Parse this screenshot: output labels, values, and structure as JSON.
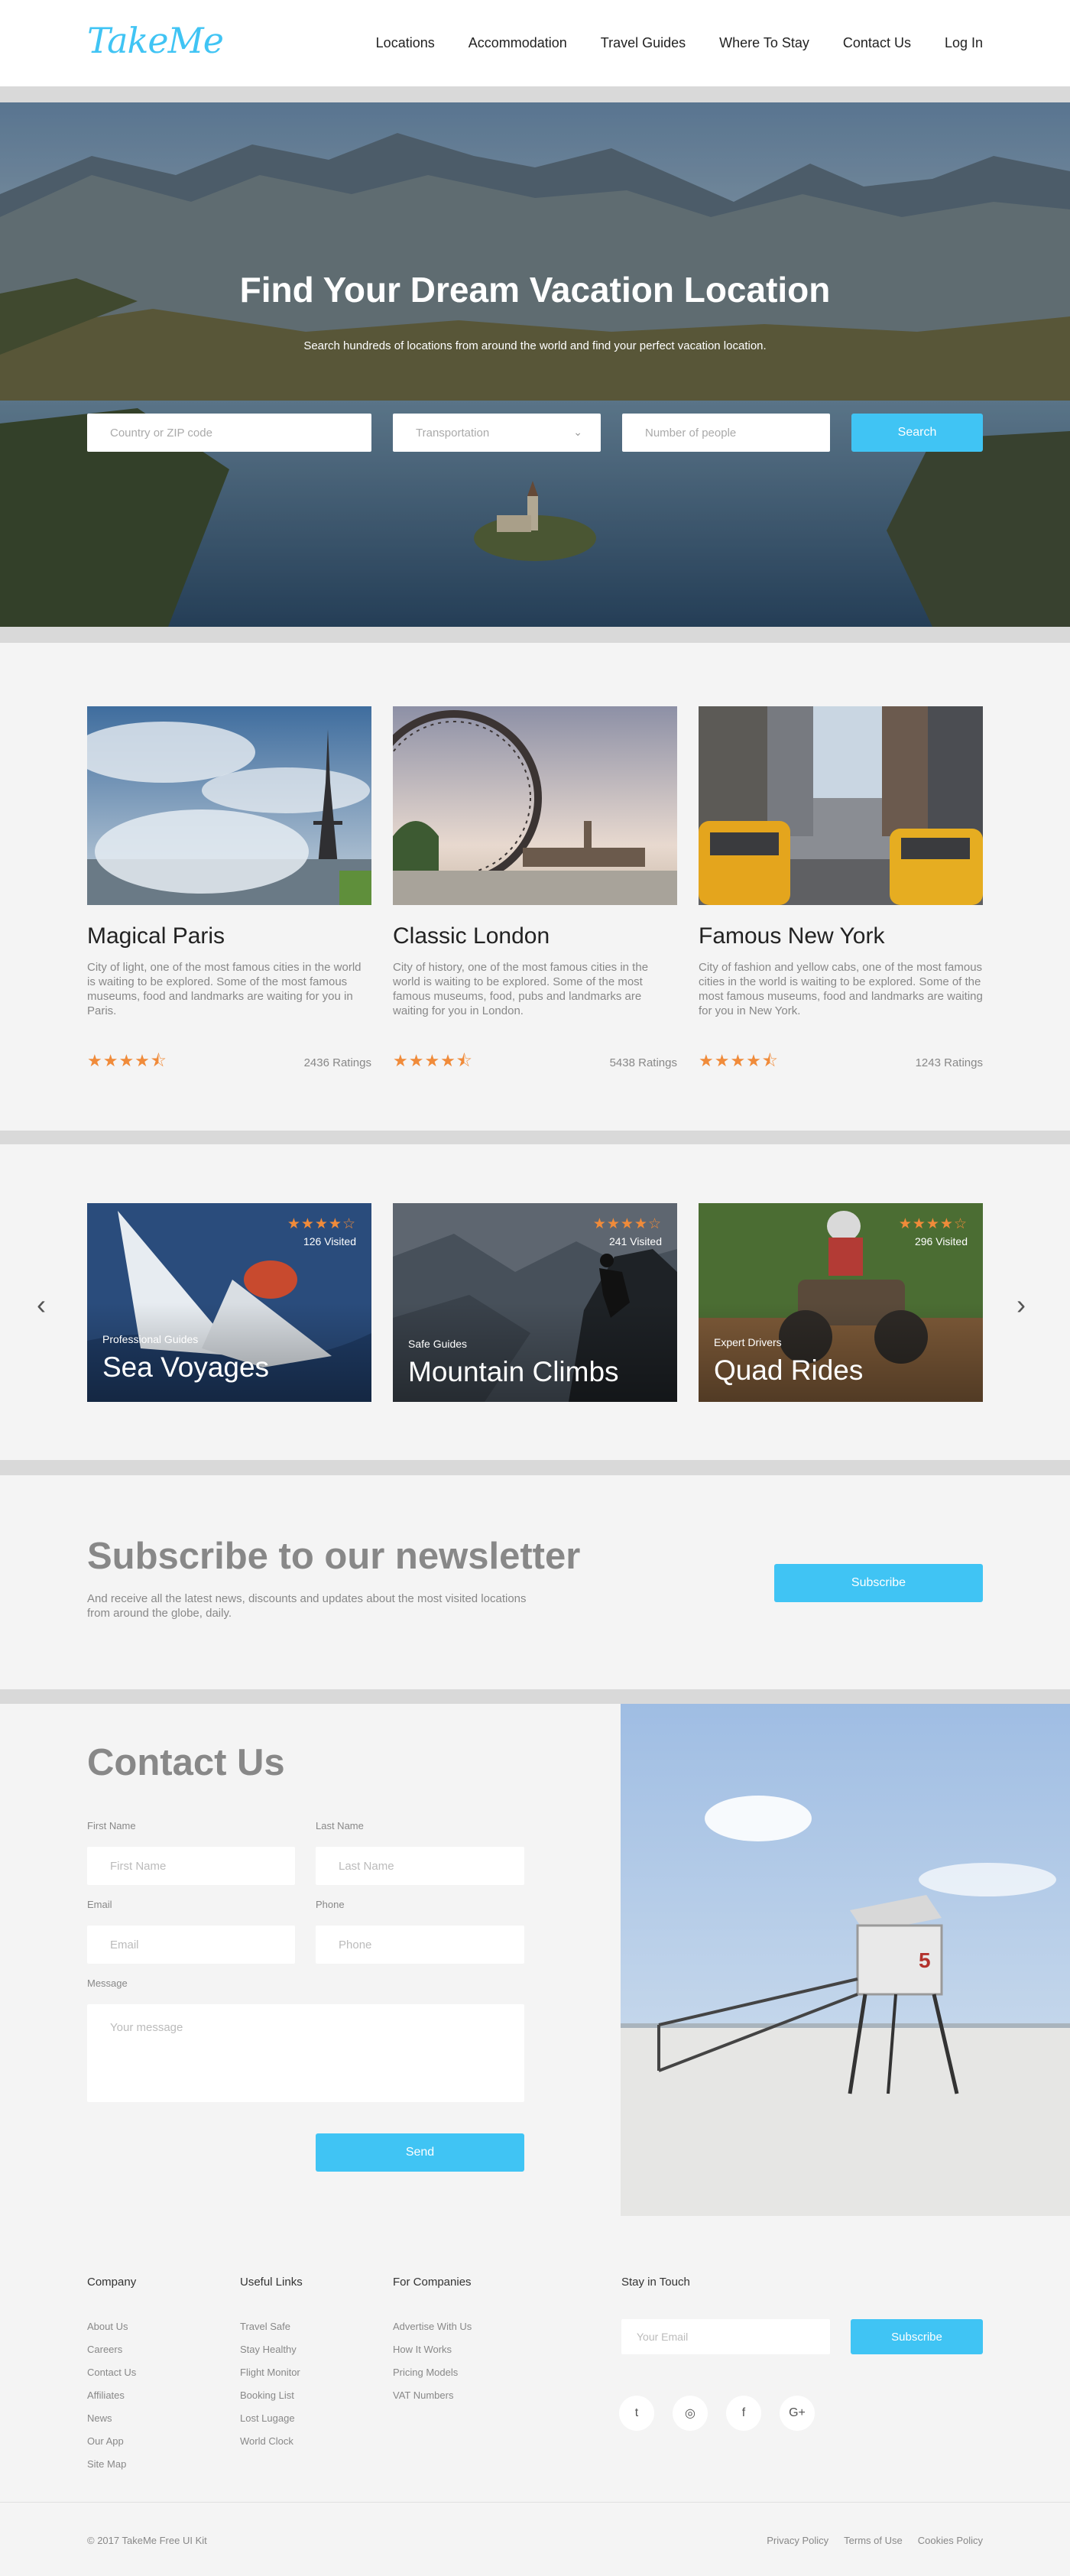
{
  "header": {
    "logo": "TakeMe",
    "nav": [
      "Locations",
      "Accommodation",
      "Travel Guides",
      "Where To Stay",
      "Contact Us",
      "Log In"
    ]
  },
  "hero": {
    "title": "Find Your Dream Vacation Location",
    "subtitle": "Search hundreds of locations from around the world and find your perfect vacation location.",
    "location_placeholder": "Country or ZIP code",
    "transport_placeholder": "Transportation",
    "people_placeholder": "Number of people",
    "search_label": "Search"
  },
  "destinations": [
    {
      "name": "Magical Paris",
      "description": "City of light, one of the most famous cities in the world is waiting to be explored. Some of the most famous museums, food and landmarks are waiting for you in Paris.",
      "stars": "★★★★⯪",
      "rating": 4.5,
      "ratings": "2436 Ratings"
    },
    {
      "name": "Classic London",
      "description": "City of history, one of the most famous cities in the world is waiting to be explored. Some of the most famous museums, food, pubs and landmarks are waiting for you in London.",
      "stars": "★★★★⯪",
      "rating": 4.5,
      "ratings": "5438 Ratings"
    },
    {
      "name": "Famous New York",
      "description": "City of fashion and yellow cabs, one of the most famous cities in the world is waiting to be explored. Some of the most famous museums, food and landmarks are waiting for you in New York.",
      "stars": "★★★★⯪",
      "rating": 4.5,
      "ratings": "1243 Ratings"
    }
  ],
  "activities": [
    {
      "tag": "Professional Guides",
      "name": "Sea Voyages",
      "stars": "★★★★☆",
      "rating": 4,
      "visited": "126 Visited"
    },
    {
      "tag": "Safe Guides",
      "name": "Mountain Climbs",
      "stars": "★★★★☆",
      "rating": 4,
      "visited": "241 Visited"
    },
    {
      "tag": "Expert Drivers",
      "name": "Quad Rides",
      "stars": "★★★★☆",
      "rating": 4,
      "visited": "296 Visited"
    }
  ],
  "carousel": {
    "prev": "‹",
    "next": "›"
  },
  "newsletter": {
    "title": "Subscribe to our newsletter",
    "text": "And receive all the latest news, discounts and updates about the most visited locations from around the globe, daily.",
    "button": "Subscribe"
  },
  "contact": {
    "title": "Contact Us",
    "first_name_label": "First Name",
    "first_name_placeholder": "First Name",
    "last_name_label": "Last Name",
    "last_name_placeholder": "Last Name",
    "email_label": "Email",
    "email_placeholder": "Email",
    "phone_label": "Phone",
    "phone_placeholder": "Phone",
    "message_label": "Message",
    "message_placeholder": "Your message",
    "send": "Send"
  },
  "footer": {
    "company": {
      "title": "Company",
      "items": [
        "About Us",
        "Careers",
        "Contact Us",
        "Affiliates",
        "News",
        "Our App",
        "Site Map"
      ]
    },
    "links": {
      "title": "Useful Links",
      "items": [
        "Travel Safe",
        "Stay Healthy",
        "Flight Monitor",
        "Booking List",
        "Lost Lugage",
        "World Clock"
      ]
    },
    "companies": {
      "title": "For Companies",
      "items": [
        "Advertise With Us",
        "How It Works",
        "Pricing Models",
        "VAT Numbers"
      ]
    },
    "touch": {
      "title": "Stay in Touch",
      "email_placeholder": "Your Email",
      "button": "Subscribe"
    },
    "social": [
      {
        "icon": "twitter-icon",
        "glyph": "t"
      },
      {
        "icon": "instagram-icon",
        "glyph": "◎"
      },
      {
        "icon": "facebook-icon",
        "glyph": "f"
      },
      {
        "icon": "google-plus-icon",
        "glyph": "G+"
      }
    ],
    "copyright": "© 2017 TakeMe Free UI Kit",
    "legal": [
      "Privacy Policy",
      "Terms of Use",
      "Cookies Policy"
    ]
  },
  "colors": {
    "accent": "#40c4f4",
    "star": "#f08b3a",
    "band": "#d9d9d9",
    "background": "#f4f4f4"
  }
}
